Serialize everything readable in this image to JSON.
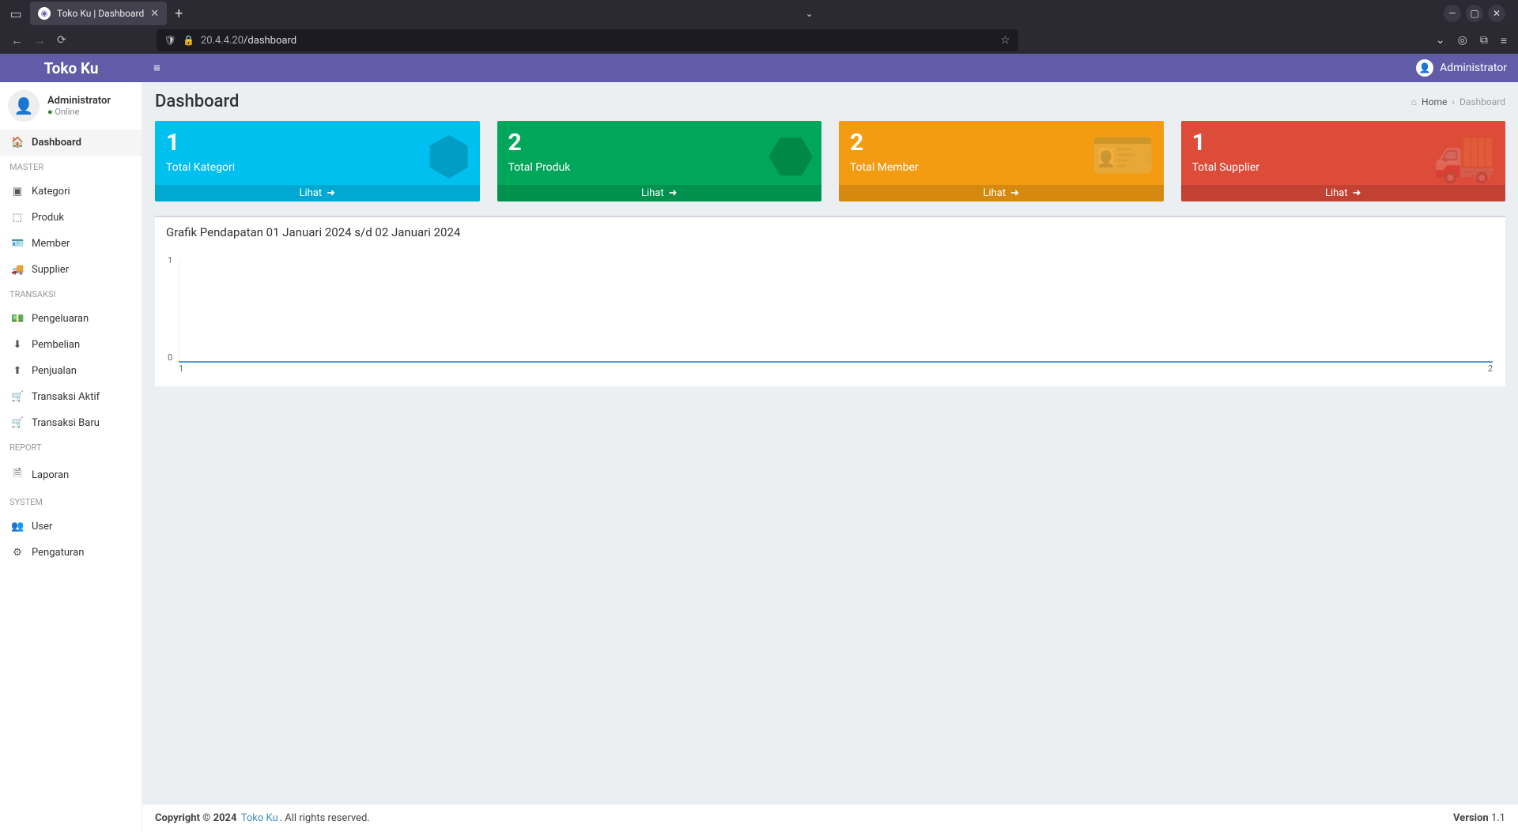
{
  "browser": {
    "tab_title": "Toko Ku | Dashboard",
    "url_host": "20.4.4.20",
    "url_path": "/dashboard"
  },
  "header": {
    "brand": "Toko Ku",
    "user_name": "Administrator"
  },
  "sidebar": {
    "user_name": "Administrator",
    "user_status": "Online",
    "items": [
      {
        "section": null,
        "icon": "dashboard-icon",
        "glyph": "🏠",
        "label": "Dashboard",
        "active": true
      },
      {
        "section": "MASTER",
        "icon": "cube-icon",
        "glyph": "▣",
        "label": "Kategori",
        "active": false
      },
      {
        "section": null,
        "icon": "cubes-icon",
        "glyph": "⬚",
        "label": "Produk",
        "active": false
      },
      {
        "section": null,
        "icon": "id-card-icon",
        "glyph": "🪪",
        "label": "Member",
        "active": false
      },
      {
        "section": null,
        "icon": "truck-icon",
        "glyph": "🚚",
        "label": "Supplier",
        "active": false
      },
      {
        "section": "TRANSAKSI",
        "icon": "money-icon",
        "glyph": "💵",
        "label": "Pengeluaran",
        "active": false
      },
      {
        "section": null,
        "icon": "download-icon",
        "glyph": "⬇",
        "label": "Pembelian",
        "active": false
      },
      {
        "section": null,
        "icon": "upload-icon",
        "glyph": "⬆",
        "label": "Penjualan",
        "active": false
      },
      {
        "section": null,
        "icon": "cart-icon",
        "glyph": "🛒",
        "label": "Transaksi Aktif",
        "active": false
      },
      {
        "section": null,
        "icon": "cart-icon",
        "glyph": "🛒",
        "label": "Transaksi Baru",
        "active": false
      },
      {
        "section": "REPORT",
        "icon": "file-icon",
        "glyph": "🗎",
        "label": "Laporan",
        "active": false
      },
      {
        "section": "SYSTEM",
        "icon": "users-icon",
        "glyph": "👥",
        "label": "User",
        "active": false
      },
      {
        "section": null,
        "icon": "cog-icon",
        "glyph": "⚙",
        "label": "Pengaturan",
        "active": false
      }
    ]
  },
  "page": {
    "title": "Dashboard",
    "breadcrumb_home": "Home",
    "breadcrumb_current": "Dashboard"
  },
  "stats": [
    {
      "value": "1",
      "label": "Total Kategori",
      "action": "Lihat",
      "color": "bg-cyan",
      "icon": "cube-icon",
      "glyph": "⬢"
    },
    {
      "value": "2",
      "label": "Total Produk",
      "action": "Lihat",
      "color": "bg-green",
      "icon": "cubes-icon",
      "glyph": "⬣"
    },
    {
      "value": "2",
      "label": "Total Member",
      "action": "Lihat",
      "color": "bg-orange",
      "icon": "id-card-icon",
      "glyph": "🪪"
    },
    {
      "value": "1",
      "label": "Total Supplier",
      "action": "Lihat",
      "color": "bg-red",
      "icon": "truck-icon",
      "glyph": "🚚"
    }
  ],
  "chart_title": "Grafik Pendapatan 01 Januari 2024 s/d 02 Januari 2024",
  "chart_data": {
    "type": "line",
    "x": [
      1,
      2
    ],
    "values": [
      0,
      0
    ],
    "xlabel": "",
    "ylabel": "",
    "ylim": [
      0,
      1
    ],
    "y_ticks": [
      "0",
      "1"
    ],
    "x_ticks": [
      "1",
      "2"
    ]
  },
  "footer": {
    "copyright_prefix": "Copyright © 2024",
    "brand": "Toko Ku",
    "rights": ". All rights reserved.",
    "version_label": "Version",
    "version_num": "1.1"
  }
}
